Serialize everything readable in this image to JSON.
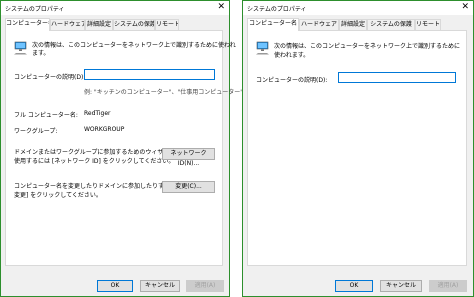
{
  "left": {
    "title": "システムのプロパティ",
    "tabs": [
      "コンピューター名",
      "ハードウェア",
      "詳細設定",
      "システムの保護",
      "リモート"
    ],
    "intro_line1": "次の情報は、このコンピューターをネットワーク上で識別するために使われ",
    "intro_line2": "ます。",
    "desc_label": "コンピューターの説明(D):",
    "desc_value": "",
    "example": "例: \"キッチンのコンピューター\"、\"仕事用コンピューター\"",
    "full_name_label": "フル コンピューター名:",
    "full_name_value": "RedTiger",
    "workgroup_label": "ワークグループ:",
    "workgroup_value": "WORKGROUP",
    "network_text1": "ドメインまたはワークグループに参加するためのウィザードを",
    "network_text2": "使用するには [ネットワーク ID] をクリックしてください。",
    "network_button": "ネットワーク ID(N)...",
    "change_text1": "コンピューター名を変更したりドメインに参加したりするには [",
    "change_text2": "変更] をクリックしてください。",
    "change_button": "変更(C)...",
    "ok": "OK",
    "cancel": "キャンセル",
    "apply": "適用(A)"
  },
  "right": {
    "title": "システムのプロパティ",
    "tabs": [
      "コンピューター名",
      "ハードウェア",
      "詳細設定",
      "システムの保護",
      "リモート"
    ],
    "intro_line1": "次の情報は、このコンピューターをネットワーク上で識別するために",
    "intro_line2": "使われます。",
    "desc_label": "コンピューターの説明(D):",
    "desc_value": "",
    "ok": "OK",
    "cancel": "キャンセル",
    "apply": "適用(A)"
  },
  "icons": {
    "close": "close-icon",
    "computer": "computer-icon"
  },
  "colors": {
    "border": "#2d8f2d",
    "focus": "#0078d7"
  }
}
